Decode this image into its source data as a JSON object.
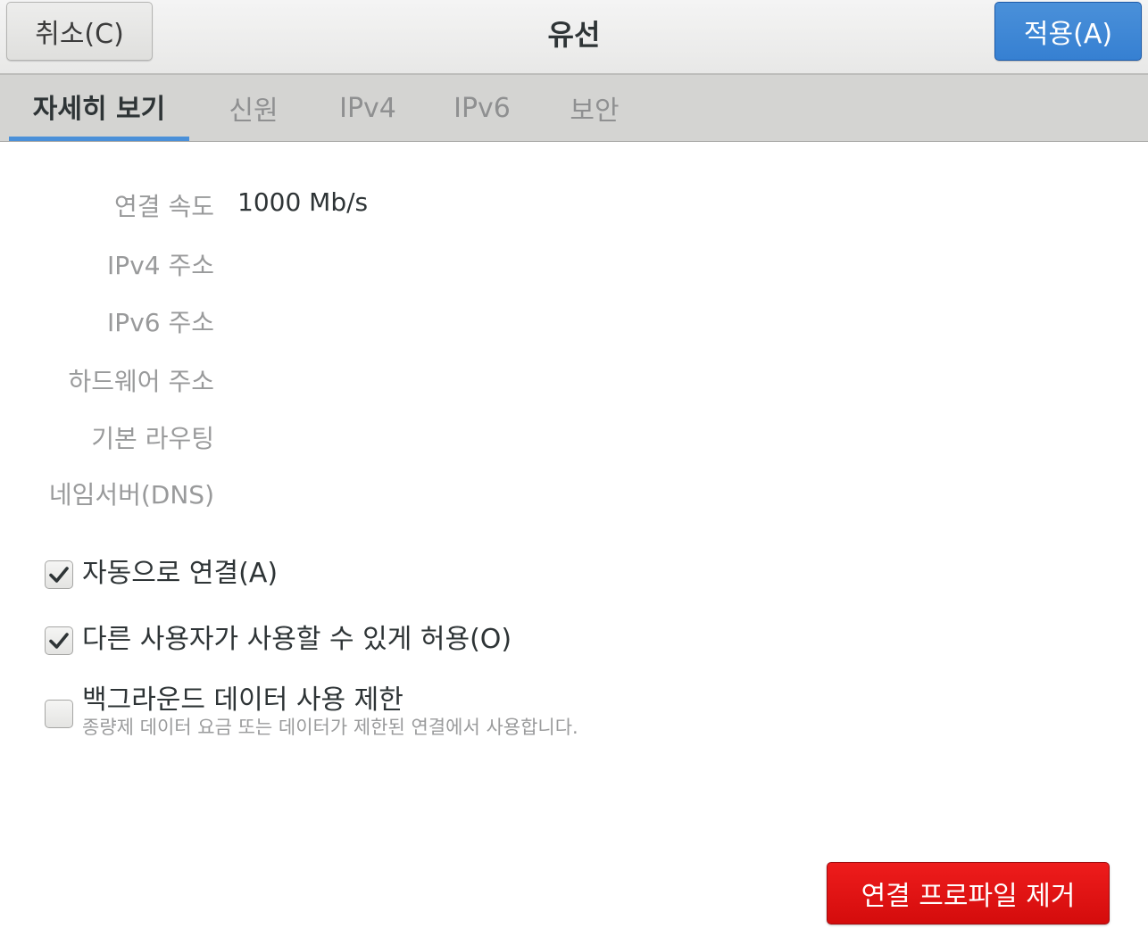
{
  "header": {
    "cancel_label": "취소(C)",
    "title": "유선",
    "apply_label": "적용(A)"
  },
  "tabs": [
    {
      "label": "자세히 보기",
      "active": true
    },
    {
      "label": "신원",
      "active": false
    },
    {
      "label": "IPv4",
      "active": false
    },
    {
      "label": "IPv6",
      "active": false
    },
    {
      "label": "보안",
      "active": false
    }
  ],
  "details": {
    "link_speed_label": "연결 속도",
    "link_speed_value": "1000 Mb/s",
    "ipv4_label": "IPv4 주소",
    "ipv6_label": "IPv6 주소",
    "hardware_label": "하드웨어 주소",
    "default_route_label": "기본 라우팅",
    "dns_label": "네임서버(DNS)"
  },
  "options": {
    "auto_connect": {
      "label": "자동으로 연결(A)",
      "checked": true
    },
    "allow_others": {
      "label": "다른 사용자가 사용할 수 있게 허용(O)",
      "checked": true
    },
    "restrict_background": {
      "label": "백그라운드 데이터 사용 제한",
      "sublabel": "종량제 데이터 요금 또는 데이터가 제한된 연결에서 사용합니다.",
      "checked": false
    }
  },
  "footer": {
    "remove_label": "연결 프로파일 제거"
  },
  "colors": {
    "accent": "#4a90d9",
    "destructive": "#e01010"
  },
  "icons": {
    "checkmark": "check-icon"
  }
}
